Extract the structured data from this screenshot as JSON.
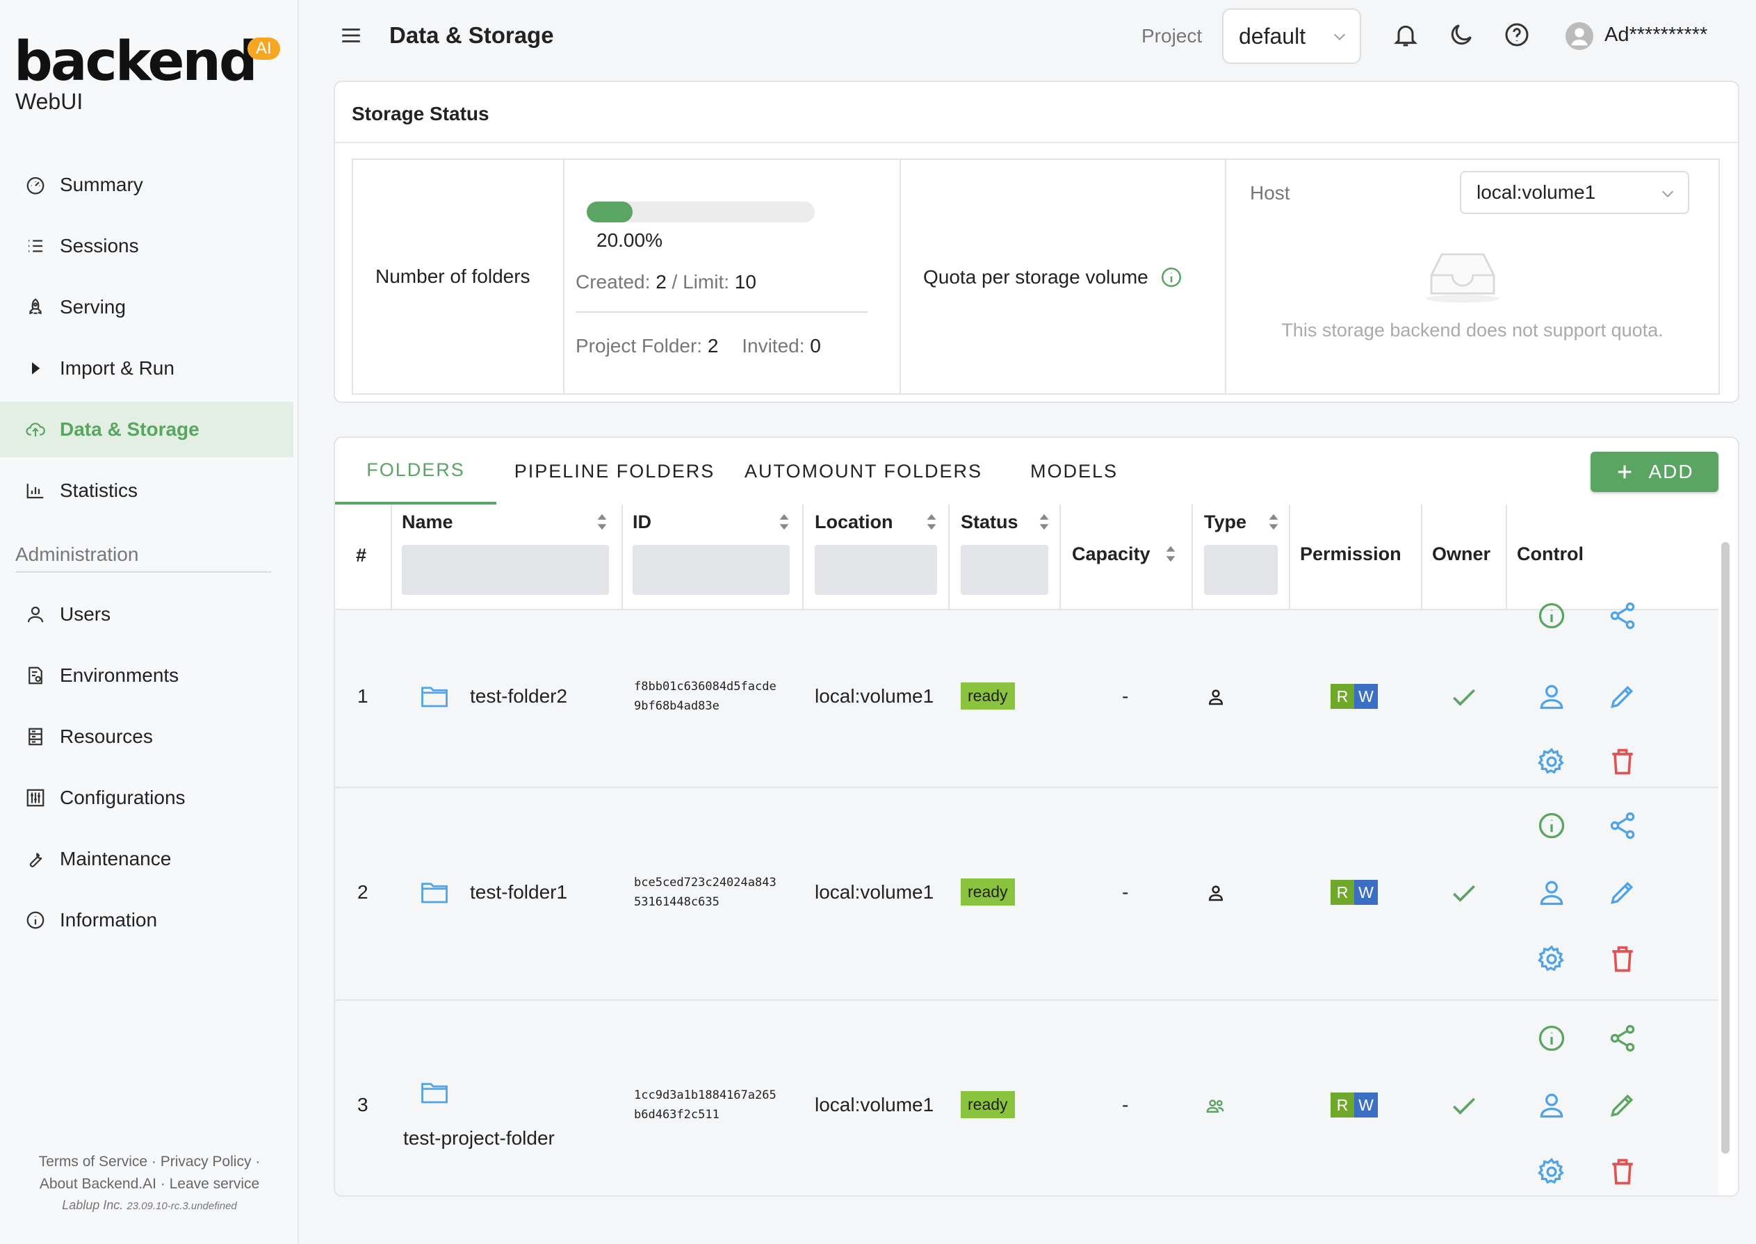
{
  "app": {
    "logo_text": "backend",
    "logo_badge": "AI",
    "logo_sub": "WebUI"
  },
  "sidebar": {
    "items": [
      {
        "label": "Summary",
        "icon": "gauge-icon"
      },
      {
        "label": "Sessions",
        "icon": "list-icon"
      },
      {
        "label": "Serving",
        "icon": "rocket-icon"
      },
      {
        "label": "Import & Run",
        "icon": "play-icon"
      },
      {
        "label": "Data & Storage",
        "icon": "cloud-upload-icon",
        "active": true
      },
      {
        "label": "Statistics",
        "icon": "bar-chart-icon"
      }
    ],
    "admin_section": "Administration",
    "admin_items": [
      {
        "label": "Users",
        "icon": "user-icon"
      },
      {
        "label": "Environments",
        "icon": "file-settings-icon"
      },
      {
        "label": "Resources",
        "icon": "server-icon"
      },
      {
        "label": "Configurations",
        "icon": "sliders-icon"
      },
      {
        "label": "Maintenance",
        "icon": "wrench-icon"
      },
      {
        "label": "Information",
        "icon": "info-icon"
      }
    ],
    "footer": {
      "terms": "Terms of Service",
      "privacy": "Privacy Policy",
      "about": "About Backend.AI",
      "leave": "Leave service",
      "company": "Lablup Inc.",
      "version": "23.09.10-rc.3.undefined"
    }
  },
  "header": {
    "title": "Data & Storage",
    "project_label": "Project",
    "project_value": "default",
    "user_name": "Ad**********"
  },
  "storage_status": {
    "title": "Storage Status",
    "folders_label": "Number of folders",
    "progress_percent": 20,
    "progress_text": "20.00%",
    "created_label": "Created:",
    "created_value": "2",
    "slash": "/",
    "limit_label": "Limit:",
    "limit_value": "10",
    "project_folder_label": "Project Folder:",
    "project_folder_value": "2",
    "invited_label": "Invited:",
    "invited_value": "0",
    "quota_label": "Quota per storage volume",
    "host_label": "Host",
    "host_value": "local:volume1",
    "quota_message": "This storage backend does not support quota."
  },
  "folders": {
    "tabs": [
      "FOLDERS",
      "PIPELINE FOLDERS",
      "AUTOMOUNT FOLDERS",
      "MODELS"
    ],
    "add_label": "ADD",
    "columns": {
      "index": "#",
      "name": "Name",
      "id": "ID",
      "location": "Location",
      "status": "Status",
      "capacity": "Capacity",
      "type": "Type",
      "permission": "Permission",
      "owner": "Owner",
      "control": "Control"
    },
    "rows": [
      {
        "index": "1",
        "name": "test-folder2",
        "id_1": "f8bb01c636084d5facde",
        "id_2": "9bf68b4ad83e",
        "location": "local:volume1",
        "status": "ready",
        "capacity": "-",
        "perm_r": "R",
        "perm_w": "W"
      },
      {
        "index": "2",
        "name": "test-folder1",
        "id_1": "bce5ced723c24024a843",
        "id_2": "53161448c635",
        "location": "local:volume1",
        "status": "ready",
        "capacity": "-",
        "perm_r": "R",
        "perm_w": "W"
      },
      {
        "index": "3",
        "name": "test-project-folder",
        "id_1": "1cc9d3a1b1884167a265",
        "id_2": "b6d463f2c511",
        "location": "local:volume1",
        "status": "ready",
        "capacity": "-",
        "perm_r": "R",
        "perm_w": "W"
      }
    ]
  },
  "colors": {
    "accent": "#5aa561",
    "folder_icon": "#4fa3e6",
    "ready": "#8ac33d",
    "perm_r": "#6fa82a",
    "perm_w": "#3b6fc3",
    "delete": "#e05353"
  }
}
